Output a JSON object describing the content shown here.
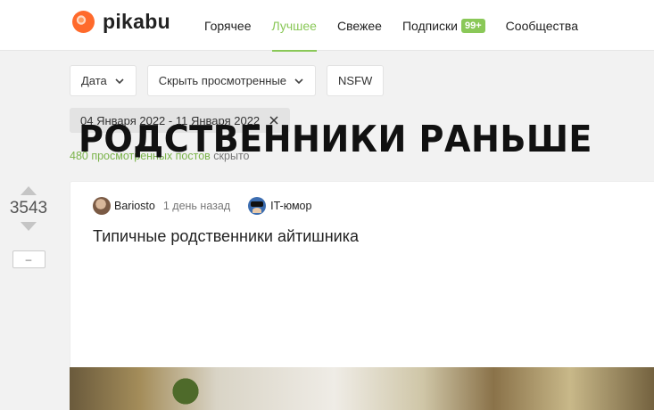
{
  "header": {
    "logo_text": "pikabu",
    "nav": [
      {
        "label": "Горячее"
      },
      {
        "label": "Лучшее"
      },
      {
        "label": "Свежее"
      },
      {
        "label": "Подписки",
        "badge": "99+"
      },
      {
        "label": "Сообщества"
      }
    ],
    "active_tab": "Лучшее"
  },
  "filters": {
    "date": "Дата",
    "hide_viewed": "Скрыть просмотренные",
    "nsfw": "NSFW"
  },
  "date_range": "04 Января 2022 - 11 Января 2022",
  "viewed": {
    "link": "480 просмотренных постов",
    "suffix": " скрыто"
  },
  "post": {
    "rating": "3543",
    "hide_label": "–",
    "author": "Bariosto",
    "time": "1 день назад",
    "community": "IT-юмор",
    "title": "Типичные родственники айтишника",
    "image_text": "РОДСТВЕННИКИ РАНЬШЕ"
  },
  "colors": {
    "accent": "#8ac858",
    "logo": "#ff6a2b"
  }
}
